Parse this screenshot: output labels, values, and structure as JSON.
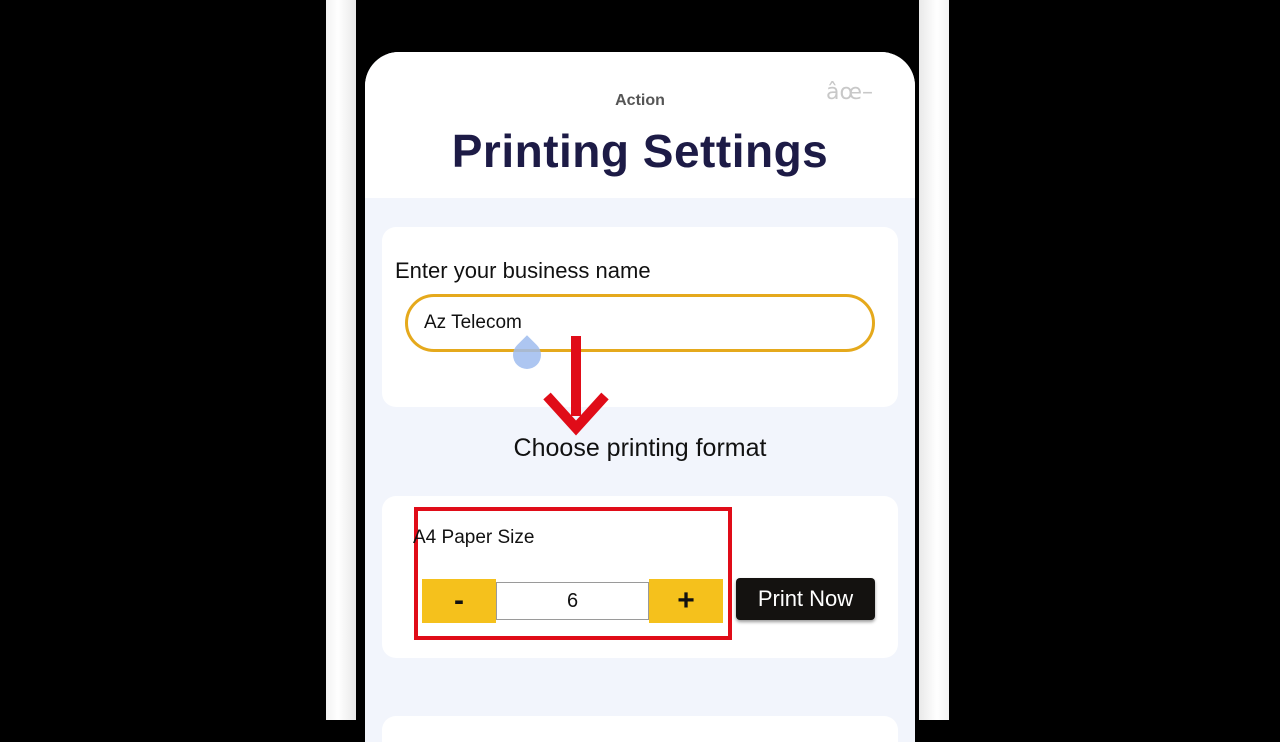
{
  "sheet": {
    "action_label": "Action",
    "close_glyph": "âœ–",
    "title": "Printing Settings"
  },
  "business": {
    "label": "Enter your business name",
    "value": "Az Telecom"
  },
  "format": {
    "heading": "Choose printing format",
    "paper_label": "A4 Paper Size",
    "minus_label": "-",
    "quantity": "6",
    "plus_label": "+",
    "print_label": "Print Now"
  },
  "icons": {
    "close": "close-icon",
    "annotation_arrow": "arrow-down-icon",
    "touch_cursor": "touch-cursor-icon"
  },
  "colors": {
    "title": "#1d1b46",
    "input_border": "#e5a91c",
    "stepper": "#f5c11c",
    "highlight": "#e00c18",
    "print_button": "#141210",
    "sheet_bg": "#f2f5fc"
  }
}
